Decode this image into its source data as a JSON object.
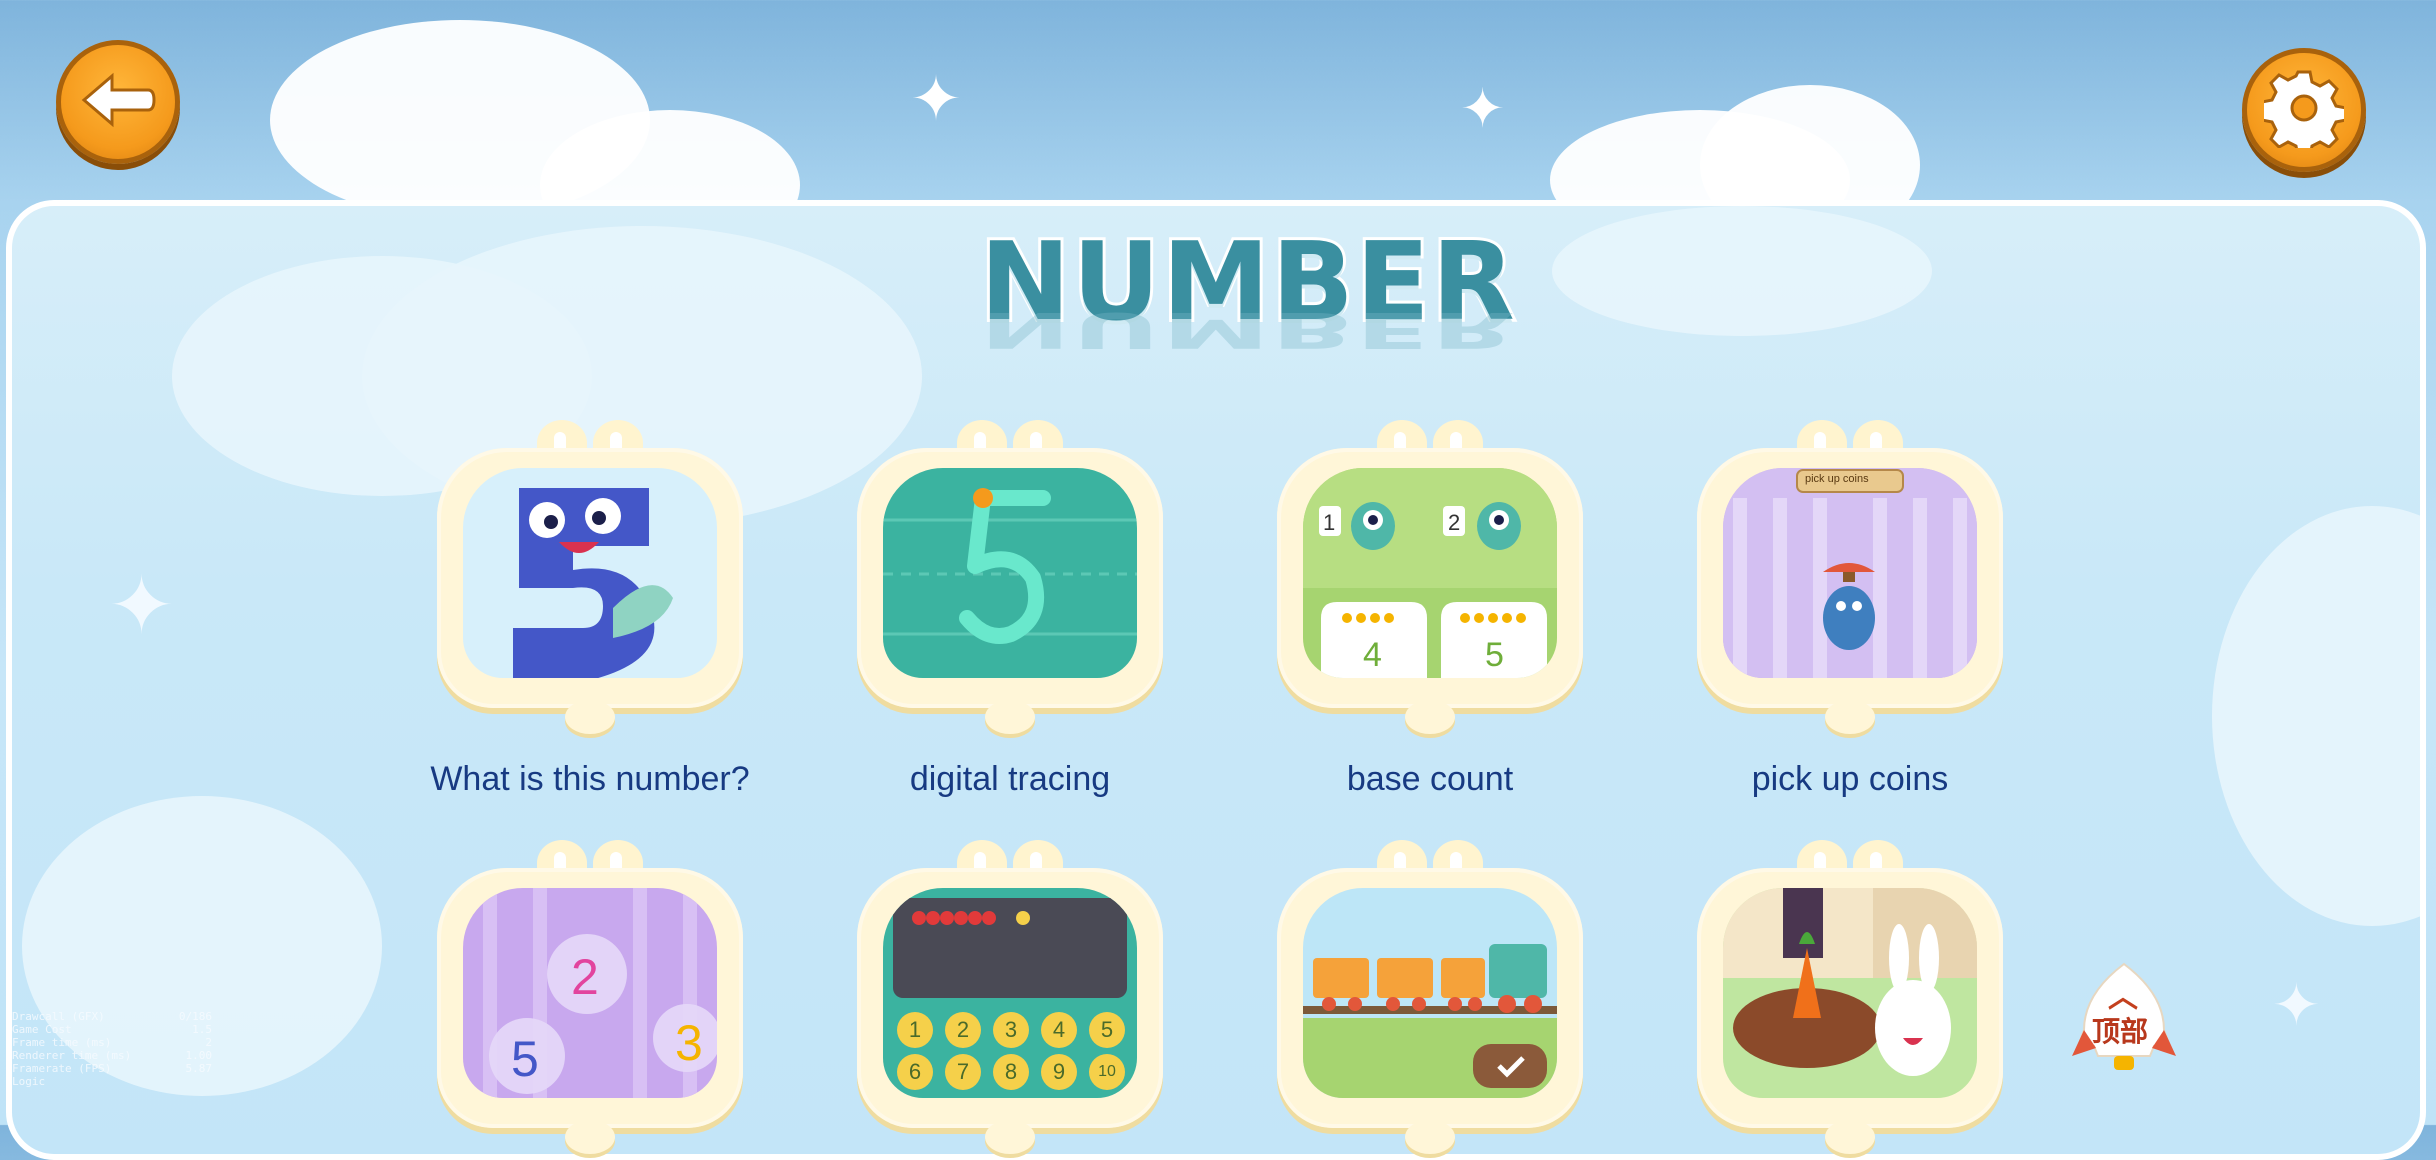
{
  "header": {
    "back_icon": "back-arrow-icon",
    "settings_icon": "gear-icon"
  },
  "title": "NUMBER",
  "games": [
    {
      "label": "What is this number?",
      "icon": "number-five-character-icon"
    },
    {
      "label": "digital tracing",
      "icon": "tracing-five-icon"
    },
    {
      "label": "base count",
      "icon": "monster-count-icon"
    },
    {
      "label": "pick up coins",
      "icon": "pick-up-coins-icon"
    },
    {
      "label": "",
      "icon": "number-bubbles-icon"
    },
    {
      "label": "",
      "icon": "keypad-board-icon"
    },
    {
      "label": "",
      "icon": "train-icon"
    },
    {
      "label": "",
      "icon": "rabbit-carrot-basket-icon"
    }
  ],
  "card3": {
    "num1": "1",
    "num2": "2",
    "count1": "4",
    "count2": "5"
  },
  "card4": {
    "sign": "pick up coins"
  },
  "card5": {
    "n1": "2",
    "n2": "5",
    "n3": "3"
  },
  "card6": {
    "keys": [
      "1",
      "2",
      "3",
      "4",
      "5",
      "6",
      "7",
      "8",
      "9",
      "10"
    ]
  },
  "top_button": {
    "label": "顶部",
    "icon": "chevron-up-icon"
  },
  "debug": {
    "rows": [
      {
        "k": "Drawcall (GFX)",
        "v": "0/186"
      },
      {
        "k": "Game Cost",
        "v": "1.5"
      },
      {
        "k": "Frame time (ms)",
        "v": "2"
      },
      {
        "k": "Renderer time (ms)",
        "v": "1.00"
      },
      {
        "k": "Framerate (FPS)",
        "v": "5.87"
      },
      {
        "k": "Logic",
        "v": ""
      }
    ]
  },
  "colors": {
    "accent": "#f59a1c",
    "label": "#173a82",
    "title": "#3a8fa0"
  }
}
